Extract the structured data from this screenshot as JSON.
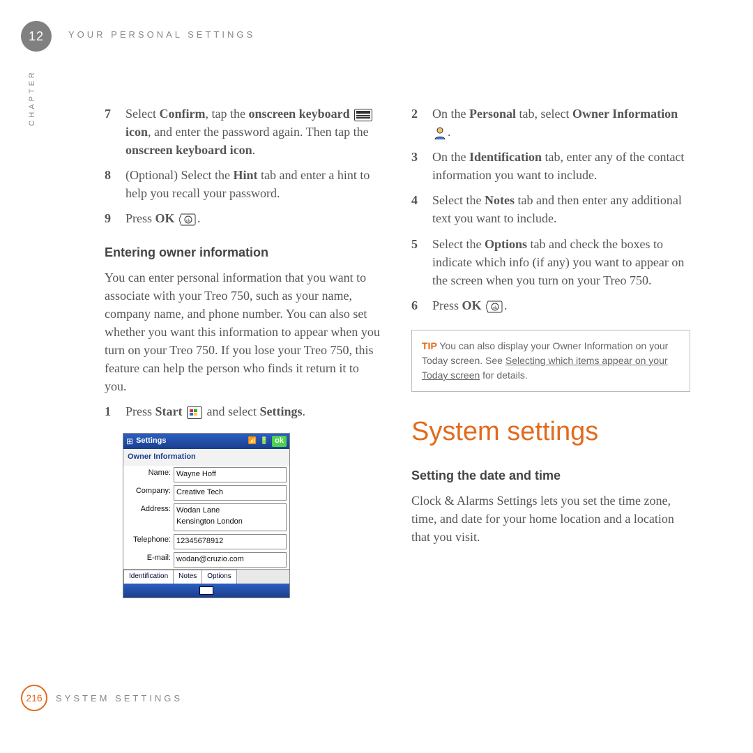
{
  "chapter_number": "12",
  "chapter_vert": "CHAPTER",
  "running_head": "YOUR PERSONAL SETTINGS",
  "left": {
    "step7": {
      "num": "7",
      "a": "Select ",
      "b": "Confirm",
      "c": ", tap the ",
      "d": "onscreen keyboard ",
      "e": " icon",
      "f": ", and enter the password again. Then tap the ",
      "g": "onscreen keyboard icon",
      "h": "."
    },
    "step8": {
      "num": "8",
      "a": "(Optional) Select the ",
      "b": "Hint",
      "c": " tab and enter a hint to help you recall your password."
    },
    "step9": {
      "num": "9",
      "a": "Press ",
      "b": "OK",
      "c": " ",
      "d": "."
    },
    "subhead": "Entering owner information",
    "para": "You can enter personal information that you want to associate with your Treo 750, such as your name, company name, and phone number. You can also set whether you want this information to appear when you turn on your Treo 750. If you lose your Treo 750, this feature can help the person who finds it return it to you.",
    "step1": {
      "num": "1",
      "a": "Press ",
      "b": "Start",
      "c": " ",
      "d": " and select ",
      "e": "Settings",
      "f": "."
    }
  },
  "right": {
    "step2": {
      "num": "2",
      "a": "On the ",
      "b": "Personal",
      "c": " tab, select ",
      "d": "Owner Information",
      "e": " ",
      "f": "."
    },
    "step3": {
      "num": "3",
      "a": "On the ",
      "b": "Identification",
      "c": " tab, enter any of the contact information you want to include."
    },
    "step4": {
      "num": "4",
      "a": "Select the ",
      "b": "Notes",
      "c": " tab and then enter any additional text you want to include."
    },
    "step5": {
      "num": "5",
      "a": "Select the ",
      "b": "Options",
      "c": " tab and check the boxes to indicate which info (if any) you want to appear on the screen when you turn on your Treo 750."
    },
    "step6": {
      "num": "6",
      "a": "Press ",
      "b": "OK",
      "c": " ",
      "d": "."
    },
    "tip": {
      "label": "TIP",
      "a": " You can also display your Owner Information on your Today screen. See ",
      "link": "Selecting which items appear on your Today screen",
      "b": " for details."
    },
    "section_title": "System settings",
    "subhead2": "Setting the date and time",
    "para2": "Clock & Alarms Settings lets you set the time zone, time, and date for your home location and a location that you visit."
  },
  "shot": {
    "titlebar_title": "Settings",
    "ok": "ok",
    "screen_title": "Owner Information",
    "labels": {
      "name": "Name:",
      "company": "Company:",
      "address": "Address:",
      "telephone": "Telephone:",
      "email": "E-mail:"
    },
    "values": {
      "name": "Wayne Hoff",
      "company": "Creative Tech",
      "address": "Wodan Lane\nKensington London",
      "telephone": "12345678912",
      "email": "wodan@cruzio.com"
    },
    "tabs": [
      "Identification",
      "Notes",
      "Options"
    ]
  },
  "footer": {
    "page": "216",
    "text": "SYSTEM SETTINGS"
  }
}
